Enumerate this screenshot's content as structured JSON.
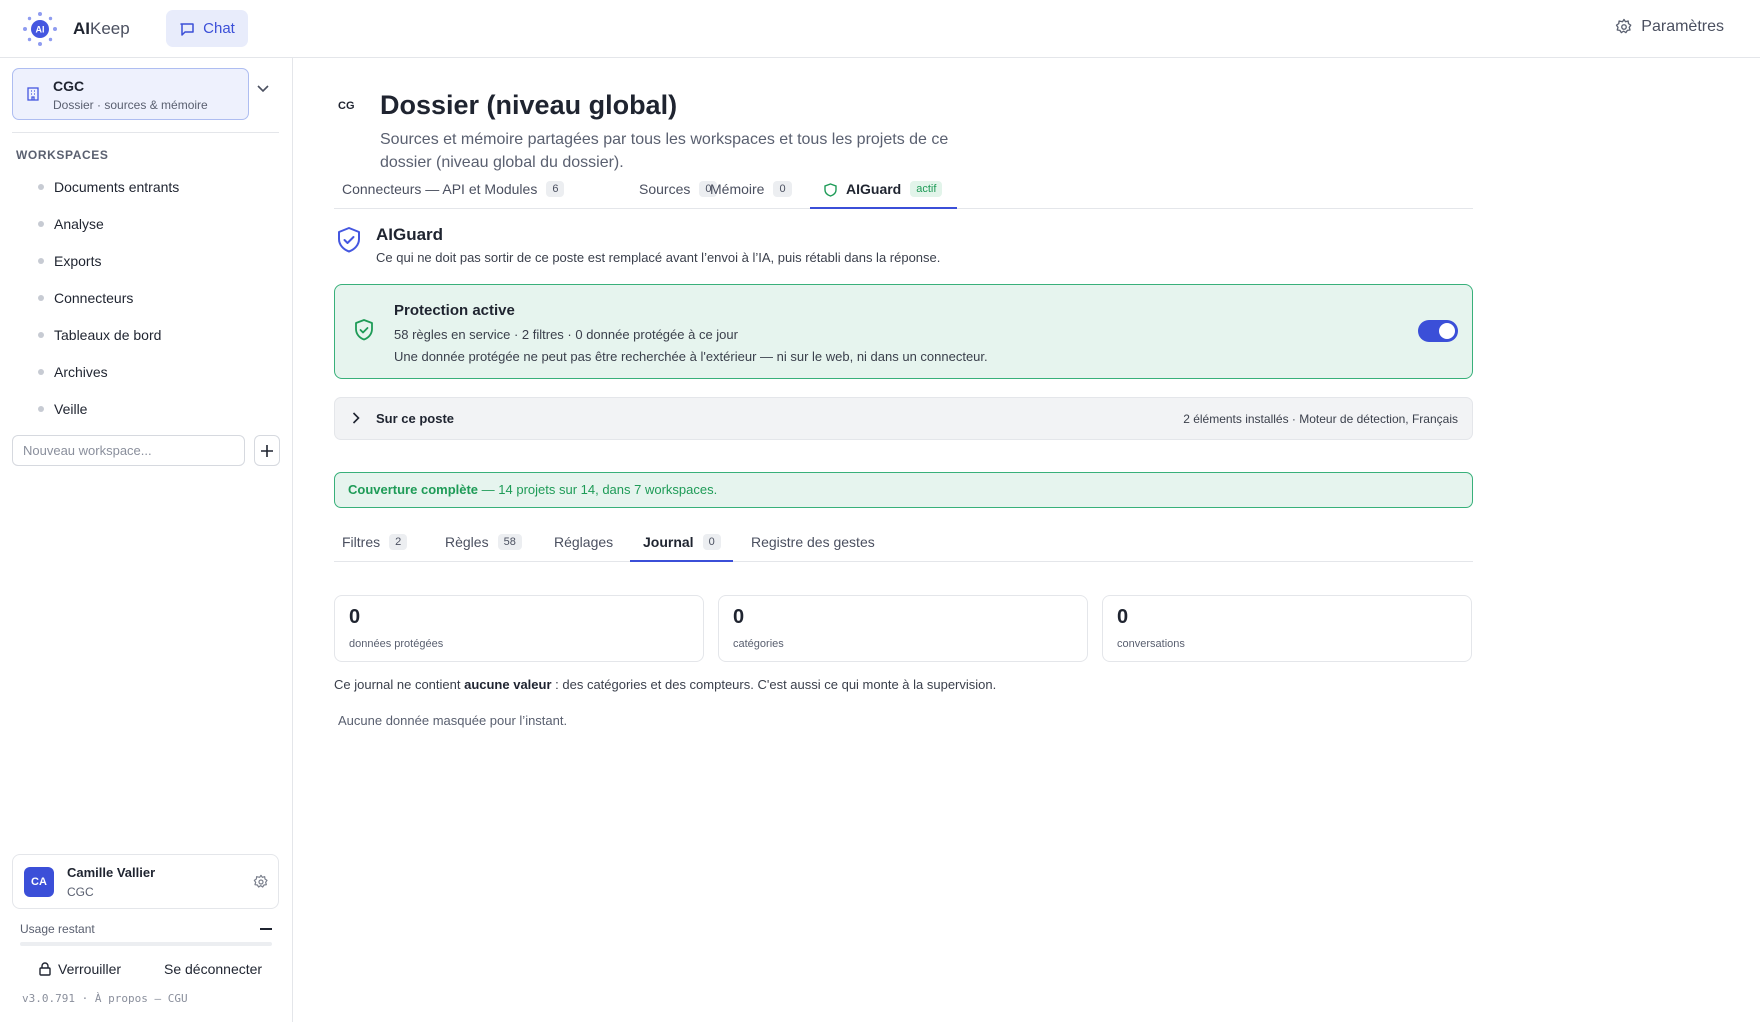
{
  "header": {
    "brand_bold": "AI",
    "brand_rest": "Keep",
    "chat_label": "Chat",
    "settings_label": "Paramètres"
  },
  "sidebar": {
    "dossier_name": "CGC",
    "dossier_sub": "Dossier · sources & mémoire",
    "workspaces_heading": "WORKSPACES",
    "workspaces": [
      "Documents entrants",
      "Analyse",
      "Exports",
      "Connecteurs",
      "Tableaux de bord",
      "Archives",
      "Veille"
    ],
    "new_workspace_placeholder": "Nouveau workspace...",
    "user": {
      "initials": "CA",
      "name": "Camille Vallier",
      "org": "CGC"
    },
    "usage_label": "Usage restant",
    "lock_label": "Verrouiller",
    "logout_label": "Se déconnecter",
    "version": "v3.0.791 · À propos — CGU"
  },
  "main": {
    "badge": "CG",
    "title": "Dossier (niveau global)",
    "subtitle": "Sources et mémoire partagées par tous les workspaces et tous les projets de ce dossier (niveau global du dossier).",
    "tabs": [
      {
        "label": "Connecteurs — API et Modules",
        "count": "6"
      },
      {
        "label": "Sources",
        "count": "0"
      },
      {
        "label": "Mémoire",
        "count": "0"
      },
      {
        "label": "AIGuard",
        "status": "actif"
      }
    ],
    "aiguard": {
      "title": "AIGuard",
      "description": "Ce qui ne doit pas sortir de ce poste est remplacé avant l’envoi à l’IA, puis rétabli dans la réponse.",
      "protection_title": "Protection active",
      "protection_line1": "58 règles en service · 2 filtres · 0 donnée protégée à ce jour",
      "protection_line2": "Une donnée protégée ne peut pas être recherchée à l'extérieur — ni sur le web, ni dans un connecteur.",
      "protection_enabled": true,
      "poste_label": "Sur ce poste",
      "poste_info": "2 éléments installés · Moteur de détection, Français",
      "coverage_bold": "Couverture complète",
      "coverage_rest": " — 14 projets sur 14, dans 7 workspaces."
    },
    "subtabs": [
      {
        "label": "Filtres",
        "count": "2"
      },
      {
        "label": "Règles",
        "count": "58"
      },
      {
        "label": "Réglages",
        "count": ""
      },
      {
        "label": "Journal",
        "count": "0"
      },
      {
        "label": "Registre des gestes",
        "count": ""
      }
    ],
    "stats": [
      {
        "value": "0",
        "label": "données protégées"
      },
      {
        "value": "0",
        "label": "catégories"
      },
      {
        "value": "0",
        "label": "conversations"
      }
    ],
    "note_pre": "Ce journal ne contient ",
    "note_bold": "aucune valeur",
    "note_post": " : des catégories et des compteurs. C'est aussi ce qui monte à la supervision.",
    "empty_text": "Aucune donnée masquée pour l’instant."
  }
}
